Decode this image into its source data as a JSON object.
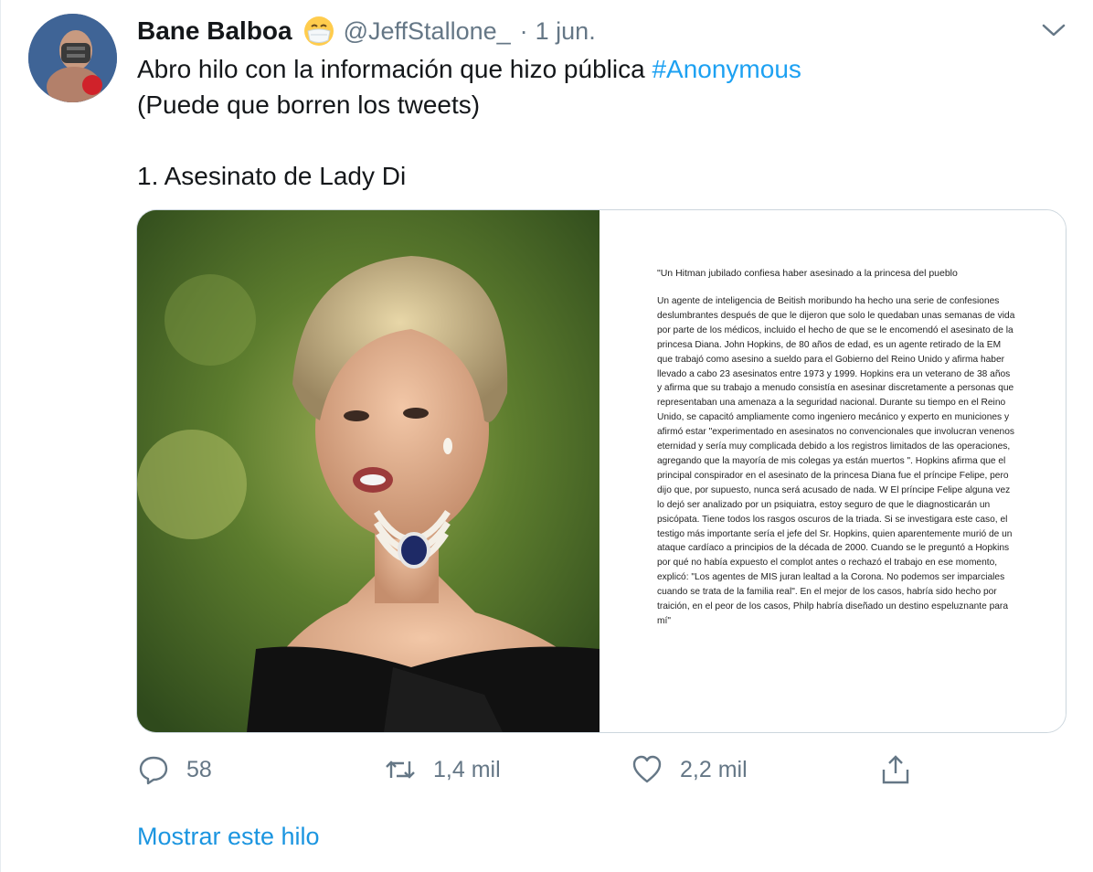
{
  "tweet": {
    "author_name": "Bane Balboa",
    "author_emoji": "mask-face-emoji",
    "handle": "@JeffStallone_",
    "separator": "·",
    "time": "1 jun.",
    "text_line1": "Abro hilo con la información que hizo pública",
    "hashtag": "#Anonymous",
    "text_line2": "(Puede que borren los tweets)",
    "text_line3": "1. Asesinato de Lady Di"
  },
  "media": {
    "photo_icon": "portrait-photo",
    "doc_title": "\"Un Hitman jubilado confiesa haber asesinado a la princesa del pueblo",
    "doc_body": " Un agente de inteligencia de Beitish moribundo ha hecho una serie de confesiones deslumbrantes después de que le dijeron que solo le quedaban unas semanas de vida por parte de los médicos, incluido el hecho de que se le encomendó el asesinato de la princesa Diana. John Hopkins, de 80 años de edad, es un agente retirado de la EM que trabajó como asesino a sueldo para el Gobierno del Reino Unido y afirma haber llevado a cabo 23 asesinatos entre 1973 y 1999. Hopkins era un veterano de 38 años y afirma que su trabajo a menudo consistía en asesinar discretamente a personas que representaban una amenaza  a la seguridad nacional. Durante su tiempo en el Reino Unido, se capacitó ampliamente como ingeniero mecánico y experto en municiones y afirmó estar \"experimentado en asesinatos no convencionales que involucran venenos eternidad y sería muy complicada debido a los registros limitados de las operaciones, agregando que la mayoría de mis colegas ya están muertos \".  Hopkins afirma que el principal conspirador en el asesinato de la princesa Diana fue el príncipe Felipe, pero dijo que, por supuesto, nunca será acusado de nada.  W El príncipe Felipe alguna vez lo dejó ser analizado por un psiquiatra, estoy seguro de que le diagnosticarán un psicópata.  Tiene todos los rasgos oscuros de la triada. Si se investigara este caso, el testigo más importante sería el jefe del Sr. Hopkins, quien aparentemente murió de un ataque cardíaco a principios de la década de 2000.  Cuando se le preguntó a Hopkins por qué no había expuesto el complot antes o rechazó el trabajo en ese momento, explicó: \"Los agentes de MIS juran lealtad a la Corona. No podemos ser imparciales cuando se trata de la familia real\". En el mejor de los casos, habría sido  hecho por traición, en el peor de los casos, Philp habría diseñado un destino espeluznante para mí\""
  },
  "actions": {
    "reply_count": "58",
    "retweet_count": "1,4 mil",
    "like_count": "2,2 mil",
    "share_icon": "share-icon"
  },
  "show_thread": "Mostrar este hilo",
  "colors": {
    "accent": "#1da1f2",
    "link": "#1b95e0",
    "secondary_text": "#657786",
    "border": "#ccd6dd"
  }
}
